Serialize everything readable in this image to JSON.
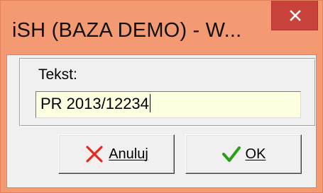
{
  "window": {
    "title": "iSH (BAZA DEMO) - W..."
  },
  "form": {
    "label": "Tekst:",
    "input_value": "PR 2013/12234"
  },
  "buttons": {
    "cancel_label": "Anuluj",
    "ok_label": "OK"
  },
  "icons": {
    "close": "close-icon",
    "cancel": "red-x-icon",
    "ok": "green-checkmark-icon"
  },
  "colors": {
    "titlebar": "#f49a73",
    "close_button": "#c9413b",
    "input_background": "#ffffe1",
    "cancel_icon": "#e8261c",
    "ok_icon": "#2c9e1e"
  }
}
